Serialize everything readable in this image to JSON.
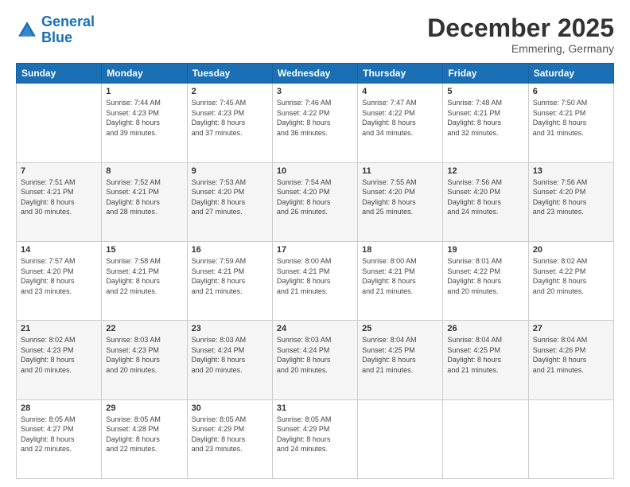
{
  "header": {
    "logo_line1": "General",
    "logo_line2": "Blue",
    "month": "December 2025",
    "location": "Emmering, Germany"
  },
  "weekdays": [
    "Sunday",
    "Monday",
    "Tuesday",
    "Wednesday",
    "Thursday",
    "Friday",
    "Saturday"
  ],
  "weeks": [
    [
      {
        "day": "",
        "text": ""
      },
      {
        "day": "1",
        "text": "Sunrise: 7:44 AM\nSunset: 4:23 PM\nDaylight: 8 hours\nand 39 minutes."
      },
      {
        "day": "2",
        "text": "Sunrise: 7:45 AM\nSunset: 4:23 PM\nDaylight: 8 hours\nand 37 minutes."
      },
      {
        "day": "3",
        "text": "Sunrise: 7:46 AM\nSunset: 4:22 PM\nDaylight: 8 hours\nand 36 minutes."
      },
      {
        "day": "4",
        "text": "Sunrise: 7:47 AM\nSunset: 4:22 PM\nDaylight: 8 hours\nand 34 minutes."
      },
      {
        "day": "5",
        "text": "Sunrise: 7:48 AM\nSunset: 4:21 PM\nDaylight: 8 hours\nand 32 minutes."
      },
      {
        "day": "6",
        "text": "Sunrise: 7:50 AM\nSunset: 4:21 PM\nDaylight: 8 hours\nand 31 minutes."
      }
    ],
    [
      {
        "day": "7",
        "text": "Sunrise: 7:51 AM\nSunset: 4:21 PM\nDaylight: 8 hours\nand 30 minutes."
      },
      {
        "day": "8",
        "text": "Sunrise: 7:52 AM\nSunset: 4:21 PM\nDaylight: 8 hours\nand 28 minutes."
      },
      {
        "day": "9",
        "text": "Sunrise: 7:53 AM\nSunset: 4:20 PM\nDaylight: 8 hours\nand 27 minutes."
      },
      {
        "day": "10",
        "text": "Sunrise: 7:54 AM\nSunset: 4:20 PM\nDaylight: 8 hours\nand 26 minutes."
      },
      {
        "day": "11",
        "text": "Sunrise: 7:55 AM\nSunset: 4:20 PM\nDaylight: 8 hours\nand 25 minutes."
      },
      {
        "day": "12",
        "text": "Sunrise: 7:56 AM\nSunset: 4:20 PM\nDaylight: 8 hours\nand 24 minutes."
      },
      {
        "day": "13",
        "text": "Sunrise: 7:56 AM\nSunset: 4:20 PM\nDaylight: 8 hours\nand 23 minutes."
      }
    ],
    [
      {
        "day": "14",
        "text": "Sunrise: 7:57 AM\nSunset: 4:20 PM\nDaylight: 8 hours\nand 23 minutes."
      },
      {
        "day": "15",
        "text": "Sunrise: 7:58 AM\nSunset: 4:21 PM\nDaylight: 8 hours\nand 22 minutes."
      },
      {
        "day": "16",
        "text": "Sunrise: 7:59 AM\nSunset: 4:21 PM\nDaylight: 8 hours\nand 21 minutes."
      },
      {
        "day": "17",
        "text": "Sunrise: 8:00 AM\nSunset: 4:21 PM\nDaylight: 8 hours\nand 21 minutes."
      },
      {
        "day": "18",
        "text": "Sunrise: 8:00 AM\nSunset: 4:21 PM\nDaylight: 8 hours\nand 21 minutes."
      },
      {
        "day": "19",
        "text": "Sunrise: 8:01 AM\nSunset: 4:22 PM\nDaylight: 8 hours\nand 20 minutes."
      },
      {
        "day": "20",
        "text": "Sunrise: 8:02 AM\nSunset: 4:22 PM\nDaylight: 8 hours\nand 20 minutes."
      }
    ],
    [
      {
        "day": "21",
        "text": "Sunrise: 8:02 AM\nSunset: 4:23 PM\nDaylight: 8 hours\nand 20 minutes."
      },
      {
        "day": "22",
        "text": "Sunrise: 8:03 AM\nSunset: 4:23 PM\nDaylight: 8 hours\nand 20 minutes."
      },
      {
        "day": "23",
        "text": "Sunrise: 8:03 AM\nSunset: 4:24 PM\nDaylight: 8 hours\nand 20 minutes."
      },
      {
        "day": "24",
        "text": "Sunrise: 8:03 AM\nSunset: 4:24 PM\nDaylight: 8 hours\nand 20 minutes."
      },
      {
        "day": "25",
        "text": "Sunrise: 8:04 AM\nSunset: 4:25 PM\nDaylight: 8 hours\nand 21 minutes."
      },
      {
        "day": "26",
        "text": "Sunrise: 8:04 AM\nSunset: 4:25 PM\nDaylight: 8 hours\nand 21 minutes."
      },
      {
        "day": "27",
        "text": "Sunrise: 8:04 AM\nSunset: 4:26 PM\nDaylight: 8 hours\nand 21 minutes."
      }
    ],
    [
      {
        "day": "28",
        "text": "Sunrise: 8:05 AM\nSunset: 4:27 PM\nDaylight: 8 hours\nand 22 minutes."
      },
      {
        "day": "29",
        "text": "Sunrise: 8:05 AM\nSunset: 4:28 PM\nDaylight: 8 hours\nand 22 minutes."
      },
      {
        "day": "30",
        "text": "Sunrise: 8:05 AM\nSunset: 4:29 PM\nDaylight: 8 hours\nand 23 minutes."
      },
      {
        "day": "31",
        "text": "Sunrise: 8:05 AM\nSunset: 4:29 PM\nDaylight: 8 hours\nand 24 minutes."
      },
      {
        "day": "",
        "text": ""
      },
      {
        "day": "",
        "text": ""
      },
      {
        "day": "",
        "text": ""
      }
    ]
  ]
}
